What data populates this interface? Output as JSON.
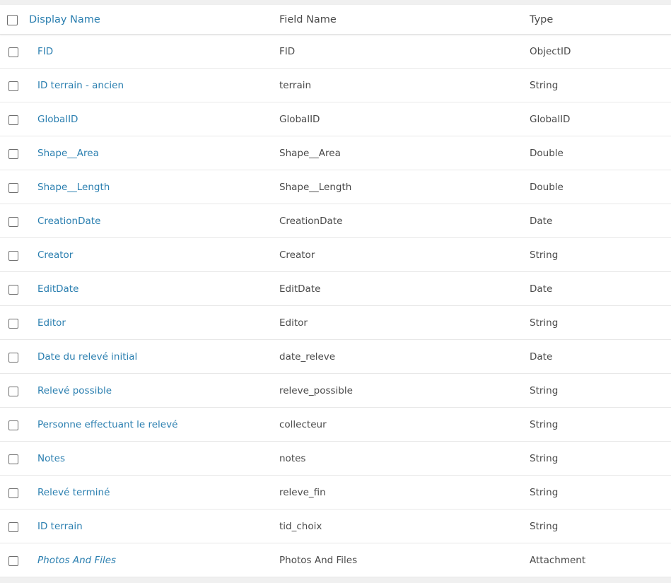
{
  "header": {
    "display_name": "Display Name",
    "field_name": "Field Name",
    "type": "Type"
  },
  "rows": [
    {
      "display": "FID",
      "field": "FID",
      "type": "ObjectID"
    },
    {
      "display": "ID terrain - ancien",
      "field": "terrain",
      "type": "String"
    },
    {
      "display": "GlobalID",
      "field": "GlobalID",
      "type": "GlobalID"
    },
    {
      "display": "Shape__Area",
      "field": "Shape__Area",
      "type": "Double"
    },
    {
      "display": "Shape__Length",
      "field": "Shape__Length",
      "type": "Double"
    },
    {
      "display": "CreationDate",
      "field": "CreationDate",
      "type": "Date"
    },
    {
      "display": "Creator",
      "field": "Creator",
      "type": "String"
    },
    {
      "display": "EditDate",
      "field": "EditDate",
      "type": "Date"
    },
    {
      "display": "Editor",
      "field": "Editor",
      "type": "String"
    },
    {
      "display": "Date du relevé initial",
      "field": "date_releve",
      "type": "Date"
    },
    {
      "display": "Relevé possible",
      "field": "releve_possible",
      "type": "String"
    },
    {
      "display": "Personne effectuant le relevé",
      "field": "collecteur",
      "type": "String"
    },
    {
      "display": "Notes",
      "field": "notes",
      "type": "String"
    },
    {
      "display": "Relevé terminé",
      "field": "releve_fin",
      "type": "String"
    },
    {
      "display": "ID terrain",
      "field": "tid_choix",
      "type": "String"
    },
    {
      "display": "Photos And Files",
      "field": "Photos And Files",
      "type": "Attachment"
    }
  ]
}
